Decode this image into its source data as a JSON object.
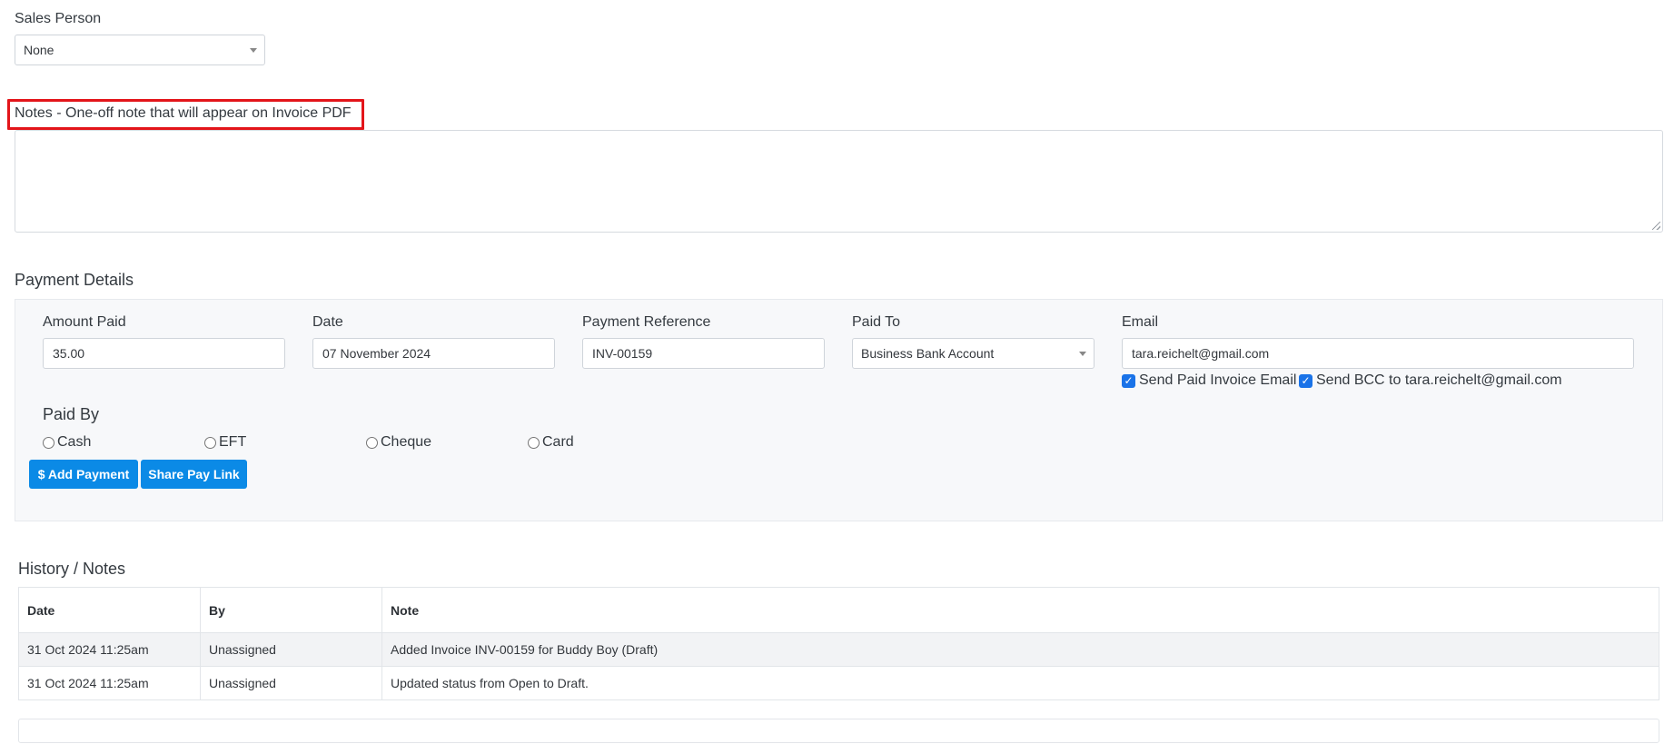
{
  "sales_person": {
    "label": "Sales Person",
    "value": "None"
  },
  "notes": {
    "label": "Notes - One-off note that will appear on Invoice PDF",
    "value": ""
  },
  "payment_details": {
    "title": "Payment Details",
    "amount_paid": {
      "label": "Amount Paid",
      "value": "35.00"
    },
    "date": {
      "label": "Date",
      "value": "07 November 2024"
    },
    "payment_reference": {
      "label": "Payment Reference",
      "value": "INV-00159"
    },
    "paid_to": {
      "label": "Paid To",
      "value": "Business Bank Account"
    },
    "email": {
      "label": "Email",
      "value": "tara.reichelt@gmail.com"
    },
    "send_paid_invoice_email": {
      "label": "Send Paid Invoice Email",
      "checked": true
    },
    "send_bcc": {
      "label": "Send BCC to tara.reichelt@gmail.com",
      "checked": true
    },
    "paid_by": {
      "label": "Paid By",
      "options": [
        "Cash",
        "EFT",
        "Cheque",
        "Card"
      ]
    },
    "add_payment_label": "$ Add Payment",
    "share_pay_link_label": "Share Pay Link"
  },
  "history": {
    "title": "History / Notes",
    "columns": [
      "Date",
      "By",
      "Note"
    ],
    "rows": [
      [
        "31 Oct 2024 11:25am",
        "Unassigned",
        "Added Invoice INV-00159 for Buddy Boy (Draft)"
      ],
      [
        "31 Oct 2024 11:25am",
        "Unassigned",
        "Updated status from Open to Draft."
      ]
    ]
  },
  "colors": {
    "primary_button": "#0b8ae6",
    "highlight_box": "#e3151a",
    "checkbox": "#1a73e8"
  }
}
